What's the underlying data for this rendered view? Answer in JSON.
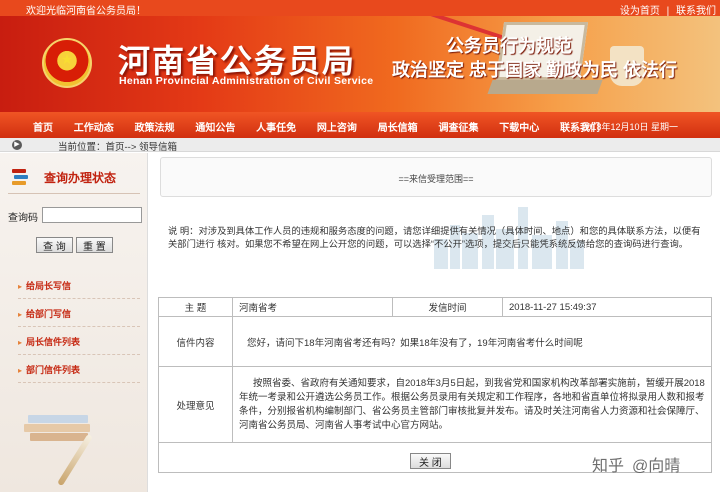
{
  "topbar": {
    "welcome": "欢迎光临河南省公务员局！",
    "links": [
      "设为首页",
      "联系我们"
    ]
  },
  "banner": {
    "title": "河南省公务员局",
    "subtitle": "Henan Provincial Administration of Civil Service",
    "slogan_title": "公务员行为规范",
    "slogan_line": "政治坚定 忠于国家 勤政为民 依法行"
  },
  "nav": {
    "items": [
      "首页",
      "工作动态",
      "政策法规",
      "通知公告",
      "人事任免",
      "网上咨询",
      "局长信箱",
      "调查征集",
      "下载中心",
      "联系我们"
    ],
    "date": "2018年12月10日 星期一"
  },
  "location": {
    "text": "当前位置：首页--> 领导信箱"
  },
  "sidebar": {
    "header": "查询办理状态",
    "query_label": "查询码",
    "query_value": "",
    "btn_query": "查 询",
    "btn_reset": "重 置",
    "links": [
      "给局长写信",
      "给部门写信",
      "局长信件列表",
      "部门信件列表"
    ]
  },
  "main": {
    "panel_title": "==来信受理范围==",
    "description": "说 明：对涉及到具体工作人员的违规和服务态度的问题，请您详细提供有关情况（具体时间、地点）和您的具体联系方法，以便有关部门进行 核对。如果您不希望在网上公开您的问题，可以选择“不公开”选项，提交后只能凭系统反馈给您的查询码进行查询。",
    "labels": {
      "subject": "主 题",
      "send_time": "发信时间",
      "content": "信件内容",
      "opinion": "处理意见"
    },
    "subject": "河南省考",
    "send_time": "2018-11-27 15:49:37",
    "content": "您好，请问下18年河南省考还有吗？如果18年没有了，19年河南省考什么时间呢",
    "opinion": "按照省委、省政府有关通知要求，自2018年3月5日起，到我省党和国家机构改革部署实施前，暂缓开展2018年统一考录和公开遴选公务员工作。根据公务员录用有关规定和工作程序，各地和省直单位将拟录用人数和报考条件，分别报省机构编制部门、省公务员主管部门审核批复并发布。请及时关注河南省人力资源和社会保障厅、河南省公务员局、河南省人事考试中心官方网站。",
    "close_button": "关 闭"
  },
  "watermark": {
    "brand": "知乎",
    "author": "@向晴"
  },
  "colors": {
    "primary_red": "#d12f10",
    "link_red": "#c62a14",
    "banner_orange": "#f06a1f"
  }
}
